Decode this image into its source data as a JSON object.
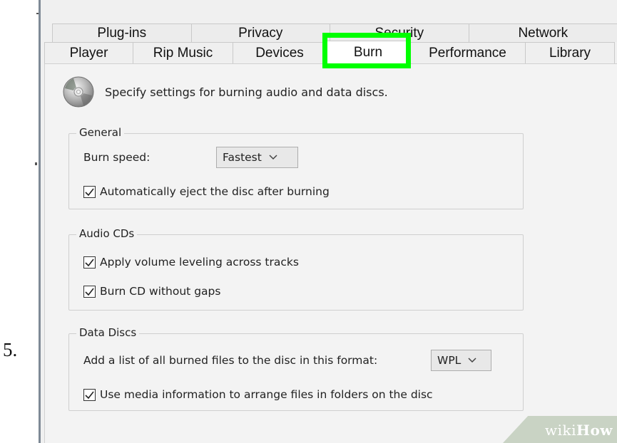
{
  "step": {
    "number": "5."
  },
  "tabs": {
    "back_row": [
      "Plug-ins",
      "Privacy",
      "Security",
      "Network"
    ],
    "front_row": [
      "Player",
      "Rip Music",
      "Devices",
      "Burn",
      "Performance",
      "Library"
    ],
    "active": "Burn"
  },
  "header": {
    "description": "Specify settings for burning audio and data discs."
  },
  "general": {
    "title": "General",
    "burn_speed_label": "Burn speed:",
    "burn_speed_value": "Fastest",
    "auto_eject_label": "Automatically eject the disc after burning",
    "auto_eject_checked": true
  },
  "audio_cds": {
    "title": "Audio CDs",
    "volume_leveling_label": "Apply volume leveling across tracks",
    "volume_leveling_checked": true,
    "no_gaps_label": "Burn CD without gaps",
    "no_gaps_checked": true
  },
  "data_discs": {
    "title": "Data Discs",
    "format_label": "Add a list of all burned files to the disc in this format:",
    "format_value": "WPL",
    "media_info_label": "Use media information to arrange files in folders on the disc",
    "media_info_checked": true
  },
  "watermark": {
    "brand_prefix": "wiki",
    "brand_suffix": "How"
  },
  "colors": {
    "highlight": "#00ff00",
    "panel_bg": "#f3f3f3"
  },
  "icons": {
    "disc": "cd-disc-icon",
    "dropdown": "chevron-down-icon",
    "check": "check-icon"
  }
}
